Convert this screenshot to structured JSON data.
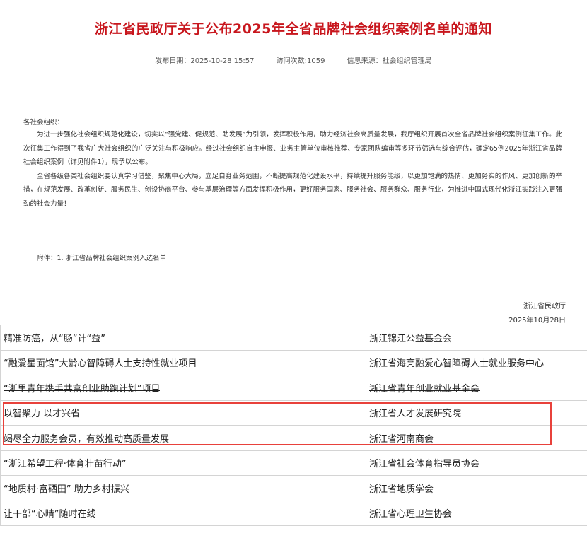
{
  "header": {
    "title": "浙江省民政厅关于公布2025年全省品牌社会组织案例名单的通知",
    "publish_date": "发布日期：2025-10-28 15:57",
    "visits": "访问次数:1059",
    "source": "信息来源：社会组织管理局"
  },
  "body": {
    "salutation": "各社会组织：",
    "paragraphs": [
      "为进一步强化社会组织规范化建设，切实以“强党建、促规范、助发展”为引领，发挥积极作用，助力经济社会高质量发展，我厅组织开展首次全省品牌社会组织案例征集工作。此次征集工作得到了我省广大社会组织的广泛关注与积极响应。经过社会组织自主申报、业务主管单位审核推荐、专家团队编审等多环节筛选与综合评估，确定65例2025年浙江省品牌社会组织案例（详见附件1），现予以公布。",
      "全省各级各类社会组织要认真学习借鉴，聚焦中心大局，立足自身业务范围，不断提高规范化建设水平，持续提升服务能级，以更加饱满的热情、更加务实的作风、更加创新的举措，在规范发展、改革创新、服务民生、创设协商平台、参与基层治理等方面发挥积极作用，更好服务国家、服务社会、服务群众、服务行业，为推进中国式现代化浙江实践注入更强劲的社会力量！"
    ],
    "attachment": "附件：1. 浙江省品牌社会组织案例入选名单",
    "signature_org": "浙江省民政厅",
    "signature_date": "2025年10月28日"
  },
  "case_list": {
    "rows": [
      {
        "case": "精准防癌，从“肠”计“益”",
        "org": "浙江锦江公益基金会"
      },
      {
        "case": "“融爱星面馆”大龄心智障碍人士支持性就业项目",
        "org": "浙江省海亮融爱心智障碍人士就业服务中心"
      },
      {
        "case": "“浙里青年携手共富创业助跑计划”项目",
        "org": "浙江省青年创业就业基金会"
      },
      {
        "case": "以智聚力 以才兴省",
        "org": "浙江省人才发展研究院"
      },
      {
        "case": "竭尽全力服务会员，有效推动高质量发展",
        "org": "浙江省河南商会"
      },
      {
        "case": "“浙江希望工程·体育壮苗行动”",
        "org": "浙江省社会体育指导员协会"
      },
      {
        "case": "“地质村·富硒田” 助力乡村振兴",
        "org": "浙江省地质学会"
      },
      {
        "case": "让干部“心晴”随时在线",
        "org": "浙江省心理卫生协会"
      }
    ]
  },
  "colors": {
    "title": "#c8161d",
    "highlight_border": "#e8413b"
  }
}
